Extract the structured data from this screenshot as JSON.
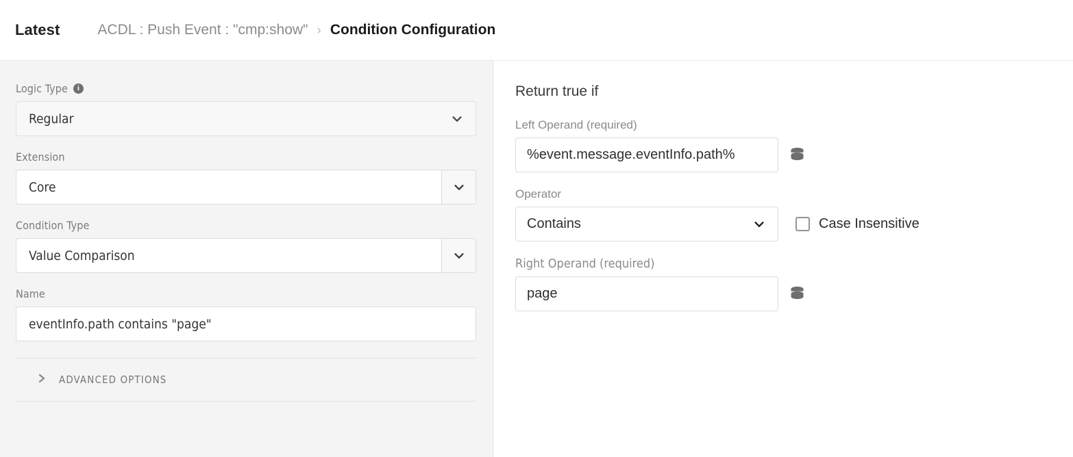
{
  "header": {
    "latest_label": "Latest",
    "breadcrumb_parent": "ACDL : Push Event : \"cmp:show\"",
    "breadcrumb_separator": "›",
    "breadcrumb_current": "Condition Configuration"
  },
  "left_panel": {
    "logic_type": {
      "label": "Logic Type",
      "info_icon": "info-icon",
      "info_glyph": "i",
      "value": "Regular",
      "chevron_icon": "chevron-down-icon"
    },
    "extension": {
      "label": "Extension",
      "value": "Core",
      "chevron_icon": "chevron-down-icon"
    },
    "condition_type": {
      "label": "Condition Type",
      "value": "Value Comparison",
      "chevron_icon": "chevron-down-icon"
    },
    "name": {
      "label": "Name",
      "value": "eventInfo.path contains \"page\"",
      "placeholder": "Name"
    },
    "advanced_options": {
      "label": "ADVANCED OPTIONS",
      "chevron_icon": "chevron-right-icon",
      "expanded": "false"
    }
  },
  "right_panel": {
    "title": "Return true if",
    "left_operand": {
      "label": "Left Operand (required)",
      "value": "%event.message.eventInfo.path%",
      "data_element_icon": "database-icon"
    },
    "operator": {
      "label": "Operator",
      "value": "Contains",
      "chevron_icon": "chevron-down-icon"
    },
    "case_insensitive": {
      "label": "Case Insensitive",
      "checked": "false"
    },
    "right_operand": {
      "label": "Right Operand (required)",
      "value": "page",
      "data_element_icon": "database-icon"
    }
  },
  "colors": {
    "panel_background": "#f4f4f4",
    "border": "#dcdcdc",
    "text_primary": "#2f2f2f",
    "text_muted": "#8a8a8a",
    "icon_gray": "#6e6e6e"
  }
}
